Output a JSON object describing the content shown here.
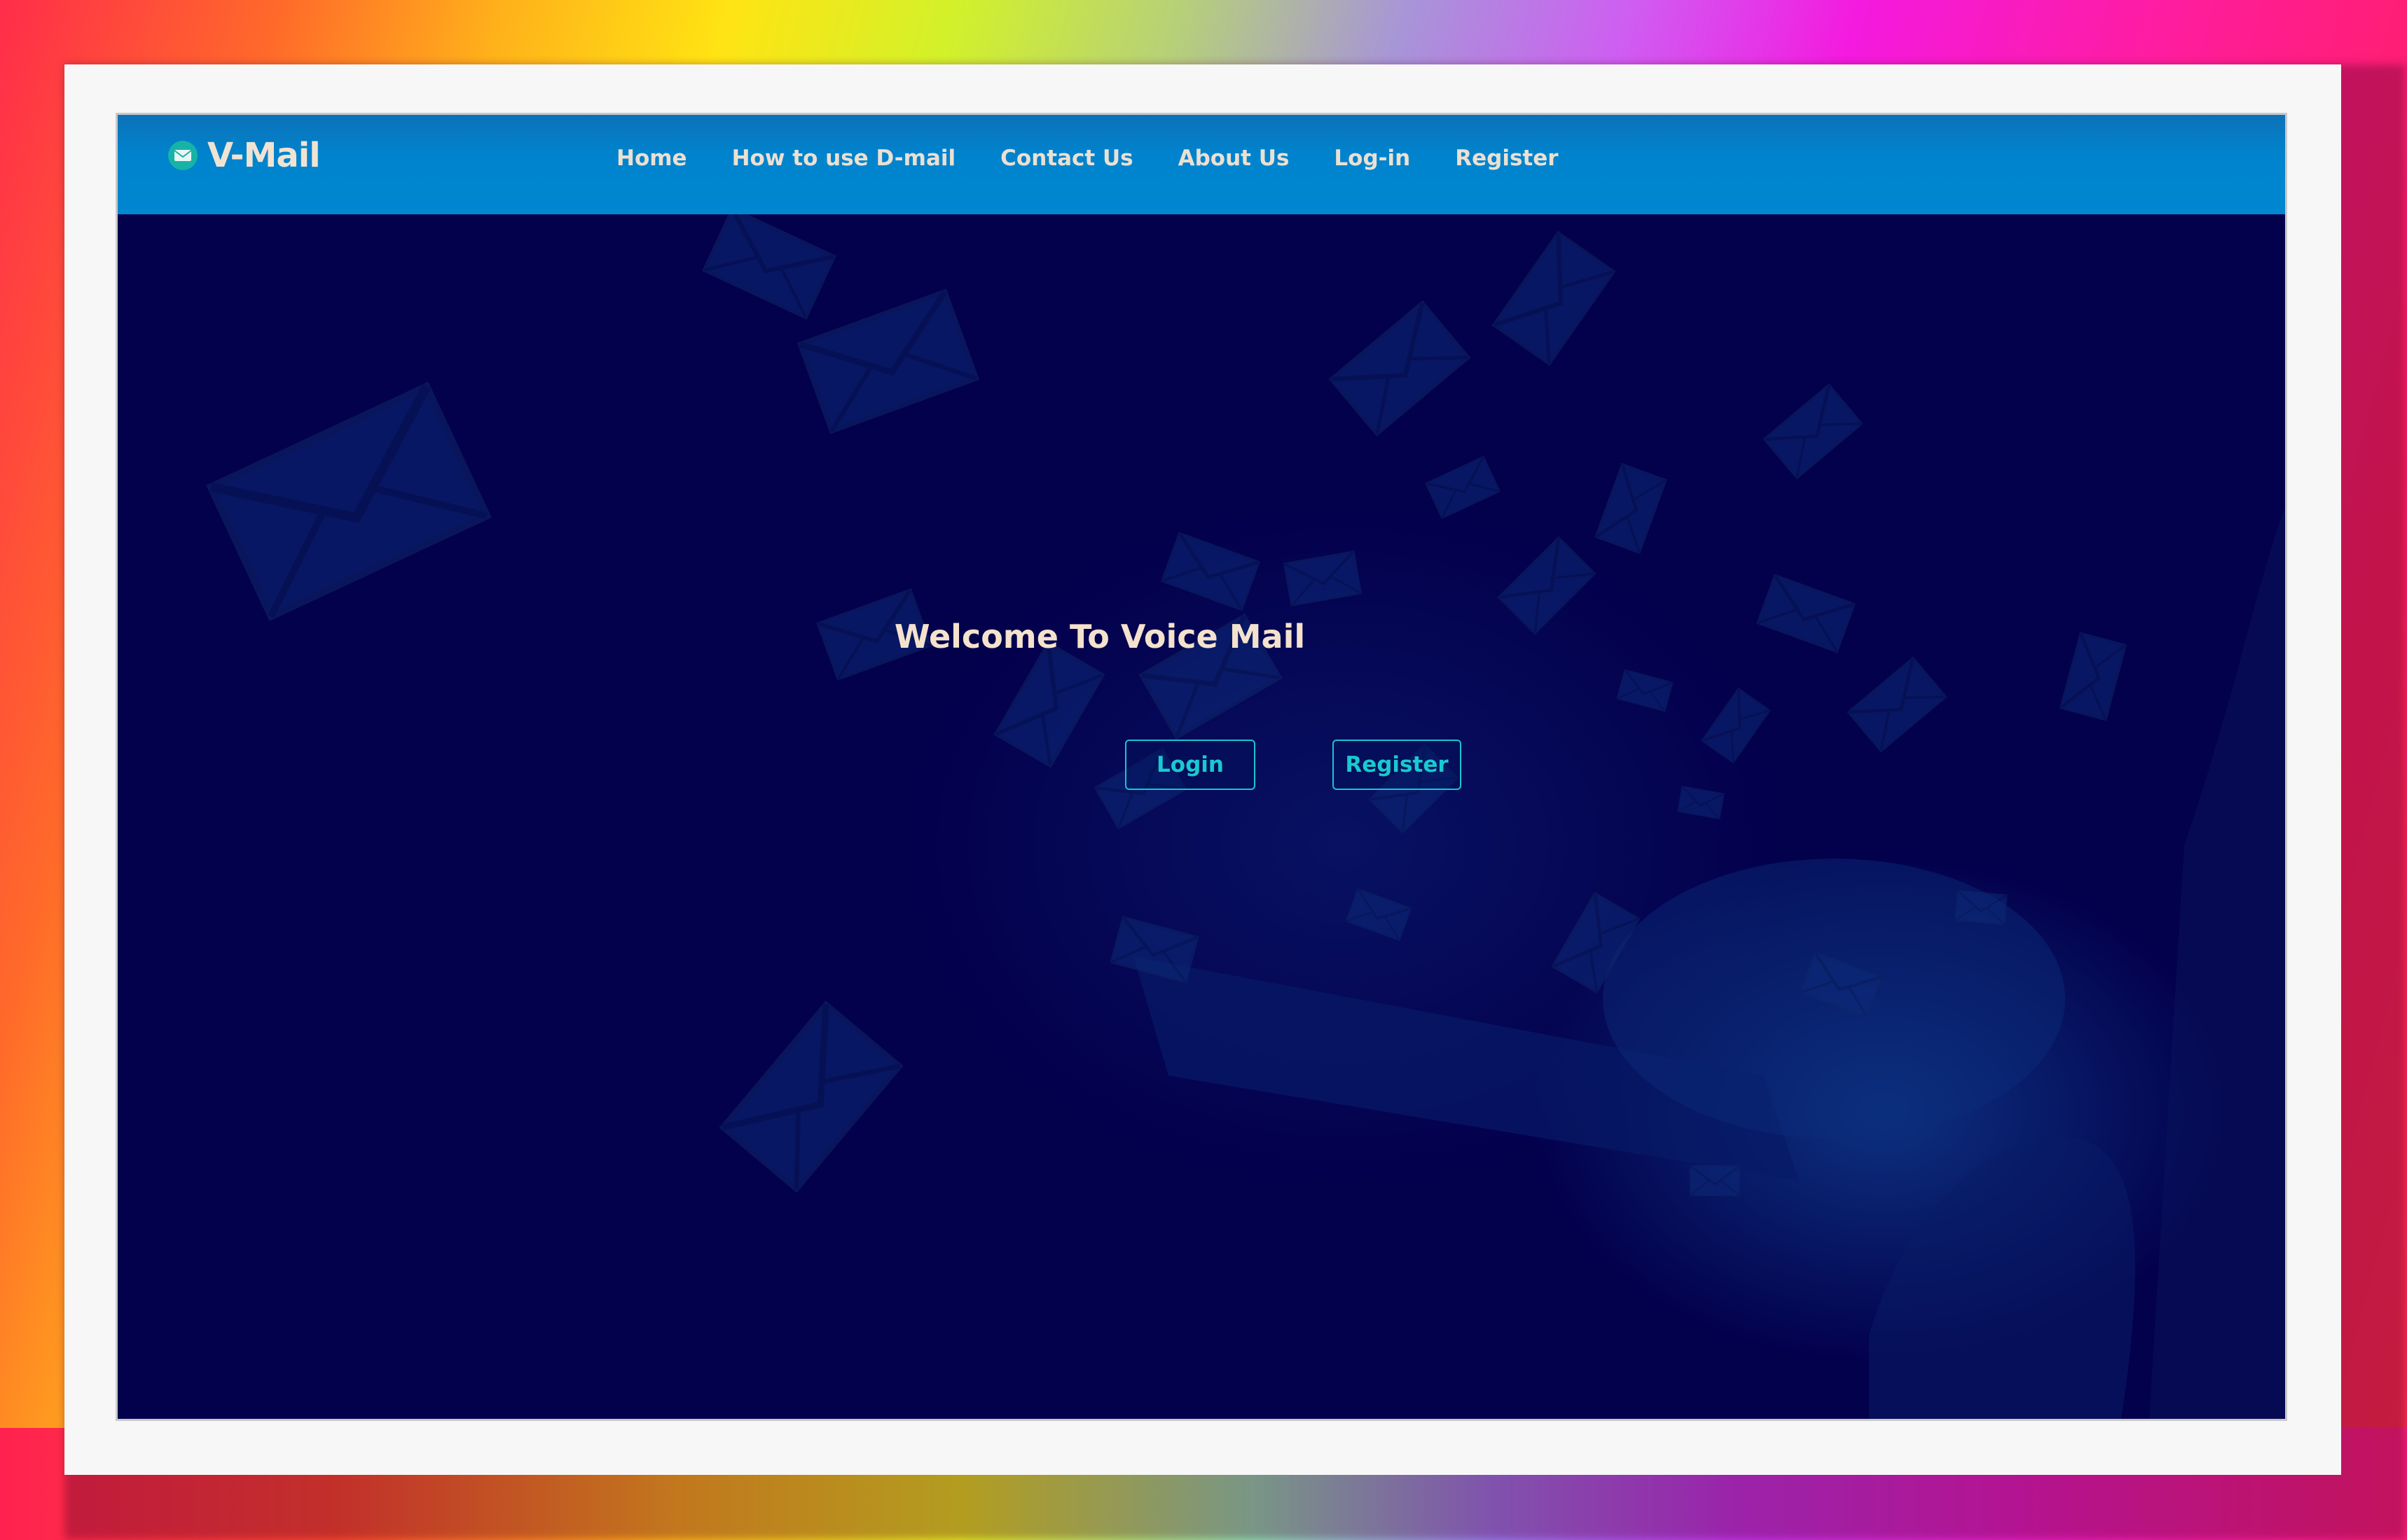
{
  "brand": {
    "name": "V-Mail",
    "icon": "envelope-icon"
  },
  "nav": {
    "items": [
      {
        "label": "Home"
      },
      {
        "label": "How to use D-mail"
      },
      {
        "label": "Contact Us"
      },
      {
        "label": "About Us"
      },
      {
        "label": "Log-in"
      },
      {
        "label": "Register"
      }
    ]
  },
  "hero": {
    "title": "Welcome To Voice Mail",
    "login_label": "Login",
    "register_label": "Register",
    "background": "flying-envelopes-phone-image"
  },
  "colors": {
    "navbar": "#0087d0",
    "hero_background": "#03004c",
    "accent": "#19c9cf",
    "text_light": "#f5e2cc",
    "brand_icon": "#17b3a6"
  }
}
